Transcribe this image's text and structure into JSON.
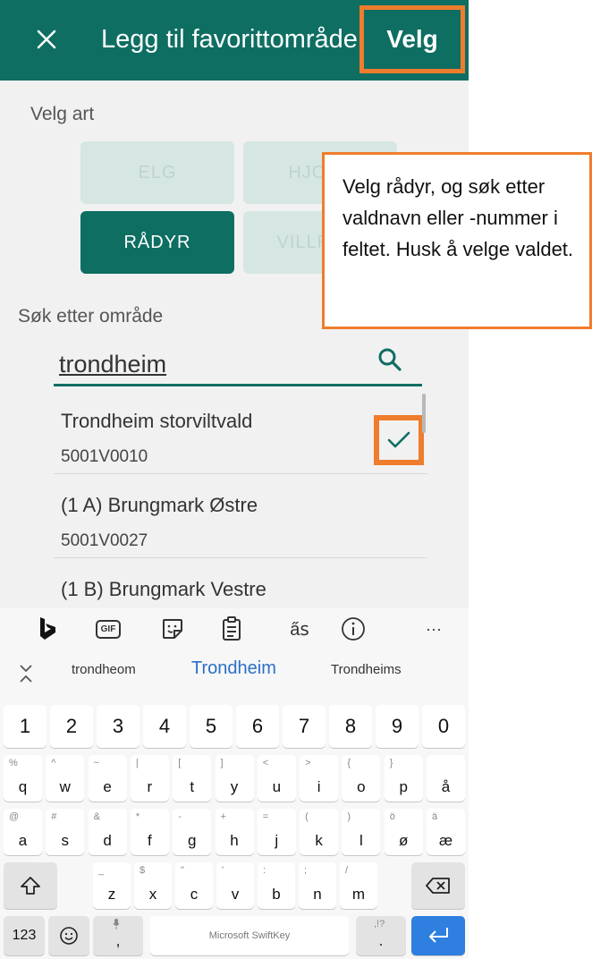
{
  "header": {
    "title": "Legg til favorittområde",
    "confirm_label": "Velg",
    "close_icon": "close-icon"
  },
  "species": {
    "label": "Velg art",
    "options": [
      {
        "label": "ELG",
        "selected": false
      },
      {
        "label": "HJORT",
        "selected": false
      },
      {
        "label": "RÅDYR",
        "selected": true
      },
      {
        "label": "VILLREIN",
        "selected": false
      }
    ]
  },
  "search": {
    "label": "Søk etter område",
    "value": "trondheim",
    "icon": "search-icon"
  },
  "results": [
    {
      "name": "Trondheim storviltvald",
      "code": "5001V0010",
      "checked": true
    },
    {
      "name": "(1 A) Brungmark Østre",
      "code": "5001V0027",
      "checked": false
    },
    {
      "name": "(1 B) Brungmark Vestre",
      "code": "",
      "checked": false
    }
  ],
  "callout": {
    "text": "Velg rådyr, og søk etter valdnavn eller -nummer i feltet. Husk å velge valdet."
  },
  "keyboard": {
    "toolbar_icons": [
      "bing-icon",
      "gif-icon",
      "sticker-icon",
      "clipboard-icon",
      "translate-icon",
      "info-icon",
      "more-icon"
    ],
    "toolbar_gif": "GIF",
    "more": "···",
    "suggestions": [
      "trondheom",
      "Trondheim",
      "Trondheims"
    ],
    "numbers": [
      "1",
      "2",
      "3",
      "4",
      "5",
      "6",
      "7",
      "8",
      "9",
      "0"
    ],
    "row1": [
      [
        "%",
        "q"
      ],
      [
        "^",
        "w"
      ],
      [
        "~",
        "e"
      ],
      [
        "|",
        "r"
      ],
      [
        "[",
        "t"
      ],
      [
        "]",
        "y"
      ],
      [
        "<",
        "u"
      ],
      [
        ">",
        "i"
      ],
      [
        "{",
        "o"
      ],
      [
        "}",
        "p"
      ],
      [
        "",
        "å"
      ]
    ],
    "row2": [
      [
        "@",
        "a"
      ],
      [
        "#",
        "s"
      ],
      [
        "&",
        "d"
      ],
      [
        "*",
        "f"
      ],
      [
        "-",
        "g"
      ],
      [
        "+",
        "h"
      ],
      [
        "=",
        "j"
      ],
      [
        "(",
        "k"
      ],
      [
        ")",
        "l"
      ],
      [
        "ö",
        "ø"
      ],
      [
        "ä",
        "æ"
      ]
    ],
    "row3": [
      [
        "_",
        "z"
      ],
      [
        "$",
        "x"
      ],
      [
        "\"",
        "c"
      ],
      [
        "'",
        "v"
      ],
      [
        ":",
        "b"
      ],
      [
        ";",
        "n"
      ],
      [
        "/",
        "m"
      ]
    ],
    "mode_label": "123",
    "comma": ",",
    "period": ".",
    "period_sub": ",!?",
    "space_label": "Microsoft SwiftKey"
  },
  "colors": {
    "brand": "#0e6e62",
    "highlight": "#ef7d2d",
    "enter": "#2e7fe0",
    "suggestion": "#2b6fc8"
  }
}
